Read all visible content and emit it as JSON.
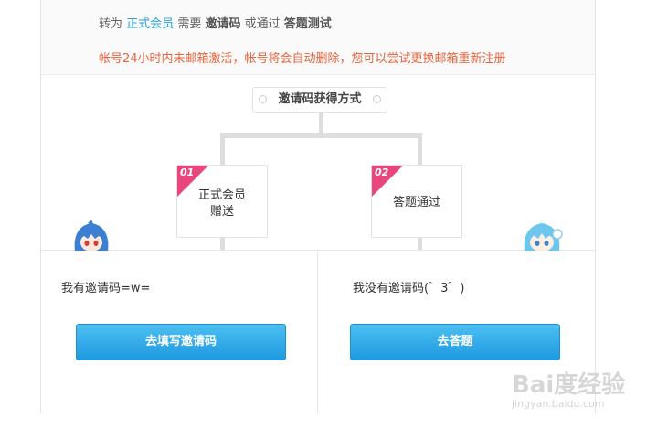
{
  "notice": {
    "prefix": "转为",
    "member_link": "正式会员",
    "needs": "需要",
    "invite_code": "邀请码",
    "or": "或通过",
    "quiz": "答题测试",
    "warning": "帐号24小时内未邮箱激活，帐号将会自动删除，您可以尝试更换邮箱重新注册"
  },
  "method_title": "邀请码获得方式",
  "cards": [
    {
      "num": "01",
      "line1": "正式会员",
      "line2": "赠送"
    },
    {
      "num": "02",
      "line1": "答题通过",
      "line2": ""
    }
  ],
  "left": {
    "label": "我有邀请码=w=",
    "button": "去填写邀请码"
  },
  "right": {
    "label": "我没有邀请码(゜3゜)",
    "button": "去答题"
  },
  "watermark": {
    "logo": "Bai度经验",
    "url": "jingyan.baidu.com"
  },
  "colors": {
    "accent": "#2aa0d8",
    "warning": "#e8623b",
    "badge": "#e8467c",
    "button": "#1f9ae0"
  }
}
